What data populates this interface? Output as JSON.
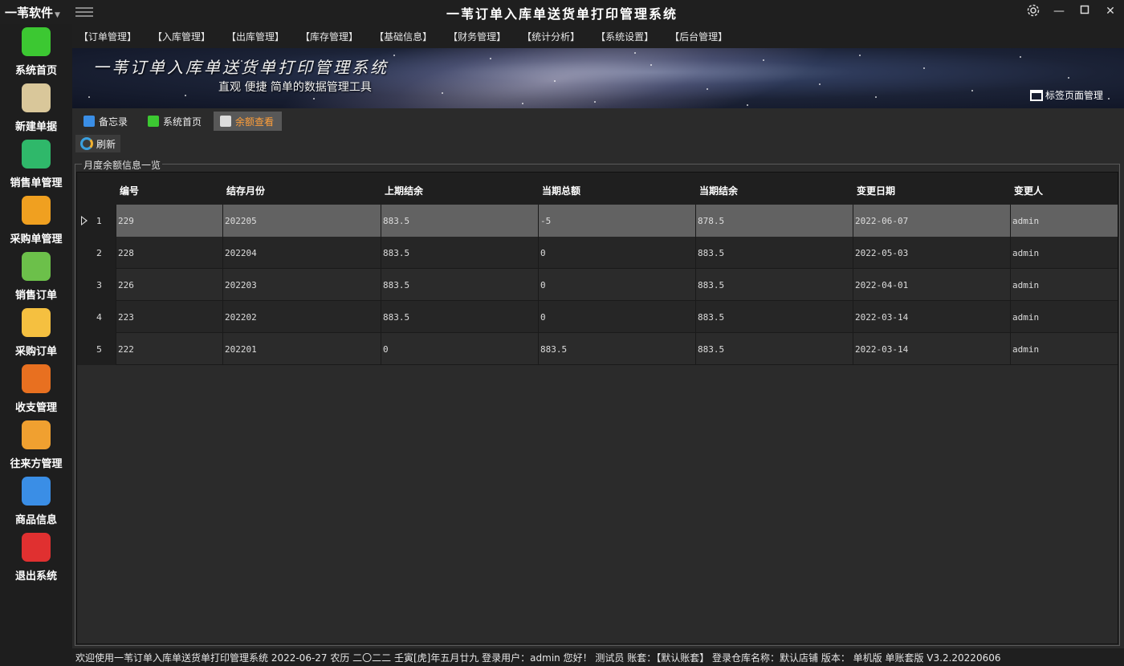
{
  "titlebar": {
    "brand": "一苇软件",
    "app_title": "一苇订单入库单送货单打印管理系统"
  },
  "sidebar": {
    "items": [
      {
        "label": "系统首页",
        "icon": "green-cube-icon",
        "color": "#3cc832"
      },
      {
        "label": "新建单据",
        "icon": "layers-plus-icon",
        "color": "#d9c79a"
      },
      {
        "label": "销售单管理",
        "icon": "box-up-icon",
        "color": "#2fb86a"
      },
      {
        "label": "采购单管理",
        "icon": "box-down-icon",
        "color": "#f0a020"
      },
      {
        "label": "销售订单",
        "icon": "dots-chat-icon",
        "color": "#6cc04a"
      },
      {
        "label": "采购订单",
        "icon": "dots-chat-icon",
        "color": "#f5c040"
      },
      {
        "label": "收支管理",
        "icon": "yuan-icon",
        "color": "#e87020"
      },
      {
        "label": "往来方管理",
        "icon": "users-icon",
        "color": "#f0a030"
      },
      {
        "label": "商品信息",
        "icon": "cubes-icon",
        "color": "#3a8ee6"
      },
      {
        "label": "退出系统",
        "icon": "exit-door-icon",
        "color": "#e03030"
      }
    ]
  },
  "menubar": {
    "items": [
      "【订单管理】",
      "【入库管理】",
      "【出库管理】",
      "【库存管理】",
      "【基础信息】",
      "【财务管理】",
      "【统计分析】",
      "【系统设置】",
      "【后台管理】"
    ]
  },
  "banner": {
    "title": "一苇订单入库单送货单打印管理系统",
    "subtitle": "直观 便捷 简单的数据管理工具",
    "tab_manager": "标签页面管理"
  },
  "tabs": [
    {
      "label": "备忘录",
      "icon": "memo-icon",
      "color": "#3a8ee6"
    },
    {
      "label": "系统首页",
      "icon": "green-cube-icon",
      "color": "#3cc832"
    },
    {
      "label": "余额查看",
      "icon": "ledger-icon",
      "color": "#dddddd",
      "active": true
    }
  ],
  "toolbar": {
    "refresh": "刷新"
  },
  "group": {
    "title": "月度余额信息一览"
  },
  "grid": {
    "columns": [
      "编号",
      "结存月份",
      "上期结余",
      "当期总额",
      "当期结余",
      "变更日期",
      "变更人"
    ],
    "rows": [
      {
        "n": "1",
        "cells": [
          "229",
          "202205",
          "883.5",
          "-5",
          "878.5",
          "2022-06-07",
          "admin"
        ]
      },
      {
        "n": "2",
        "cells": [
          "228",
          "202204",
          "883.5",
          "0",
          "883.5",
          "2022-05-03",
          "admin"
        ]
      },
      {
        "n": "3",
        "cells": [
          "226",
          "202203",
          "883.5",
          "0",
          "883.5",
          "2022-04-01",
          "admin"
        ]
      },
      {
        "n": "4",
        "cells": [
          "223",
          "202202",
          "883.5",
          "0",
          "883.5",
          "2022-03-14",
          "admin"
        ]
      },
      {
        "n": "5",
        "cells": [
          "222",
          "202201",
          "0",
          "883.5",
          "883.5",
          "2022-03-14",
          "admin"
        ]
      }
    ]
  },
  "statusbar": {
    "text": "欢迎使用一苇订单入库单送货单打印管理系统 2022-06-27 农历 二〇二二 壬寅[虎]年五月廿九 登录用户：admin 您好！ 测试员 账套：【默认账套】 登录仓库名称：默认店铺 版本：  单机版 单账套版 V3.2.20220606"
  }
}
